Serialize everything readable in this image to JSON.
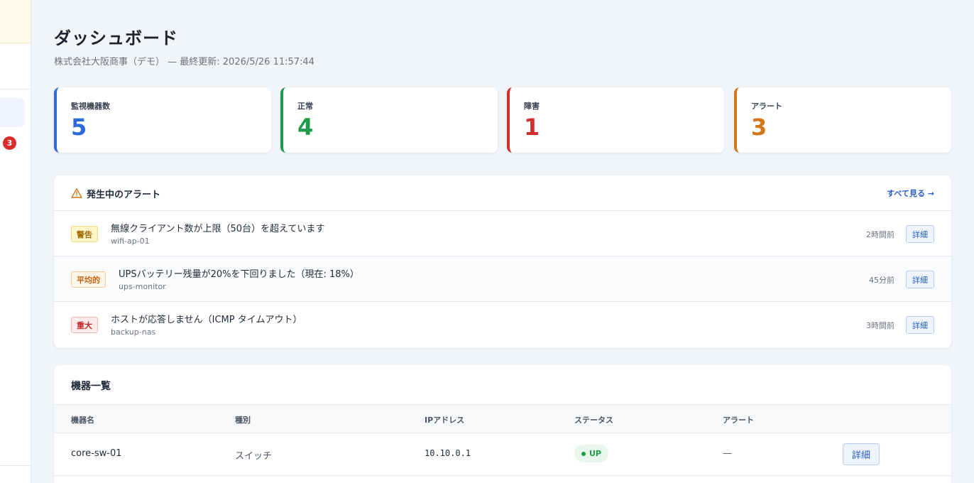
{
  "sidebar": {
    "alert_badge": "3"
  },
  "header": {
    "title": "ダッシュボード",
    "subtitle": "株式会社大阪商事（デモ） — 最終更新: 2026/5/26 11:57:44"
  },
  "stats": [
    {
      "label": "監視機器数",
      "value": "5",
      "color": "#2f6bd8"
    },
    {
      "label": "正常",
      "value": "4",
      "color": "#1f9a4a"
    },
    {
      "label": "障害",
      "value": "1",
      "color": "#d12f2f"
    },
    {
      "label": "アラート",
      "value": "3",
      "color": "#d2761a"
    }
  ],
  "alerts": {
    "title": "発生中のアラート",
    "view_all": "すべて見る →",
    "items": [
      {
        "severity": "警告",
        "message": "無線クライアント数が上限（50台）を超えています",
        "host": "wifi-ap-01",
        "time": "2時間前",
        "action": "詳細"
      },
      {
        "severity": "平均的",
        "message": "UPSバッテリー残量が20%を下回りました（現在: 18%）",
        "host": "ups-monitor",
        "time": "45分前",
        "action": "詳細"
      },
      {
        "severity": "重大",
        "message": "ホストが応答しません（ICMP タイムアウト）",
        "host": "backup-nas",
        "time": "3時間前",
        "action": "詳細"
      }
    ]
  },
  "devices": {
    "title": "機器一覧",
    "columns": [
      "機器名",
      "種別",
      "IPアドレス",
      "ステータス",
      "アラート"
    ],
    "rows": [
      {
        "name": "core-sw-01",
        "type": "スイッチ",
        "ip": "10.10.0.1",
        "status": "UP",
        "alert": "—",
        "action": "詳細"
      }
    ]
  }
}
